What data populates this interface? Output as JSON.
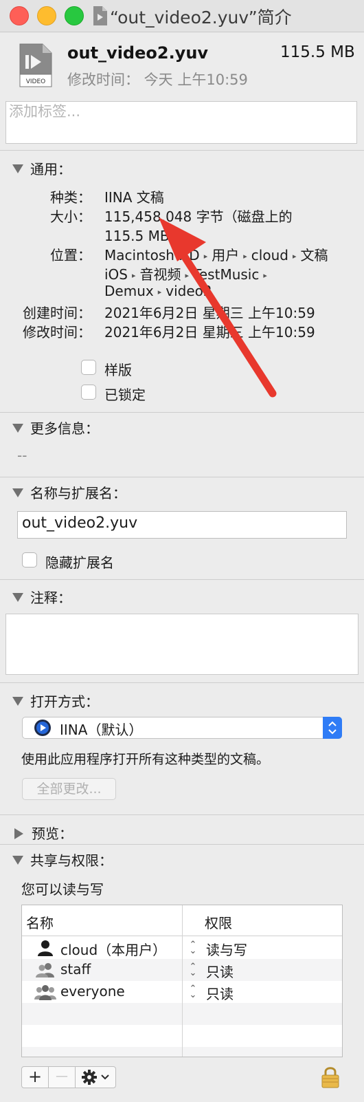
{
  "window": {
    "title": "“out_video2.yuv”简介",
    "colors": {
      "close": "#fe5f57",
      "minimize": "#febc2e",
      "zoom": "#28c840",
      "accent": "#2f7cf6",
      "annotation_arrow": "#e8382d"
    }
  },
  "header": {
    "filename": "out_video2.yuv",
    "size": "115.5 MB",
    "modified": "修改时间： 今天 上午10:59",
    "icon_label": "VIDEO"
  },
  "tags": {
    "placeholder": "添加标签..."
  },
  "general": {
    "heading": "通用：",
    "kind_label": "种类：",
    "kind_value": "IINA 文稿",
    "size_label": "大小：",
    "size_line1": "115,458,048 字节（磁盘上的",
    "size_line2": "115.5 MB）",
    "where_label": "位置：",
    "path": [
      "Macintosh HD",
      "用户",
      "cloud",
      "文稿",
      "iOS",
      "音视频",
      "TestMusic",
      "Demux",
      "video2"
    ],
    "created_label": "创建时间：",
    "created_value": "2021年6月2日 星期三 上午10:59",
    "modified_label": "修改时间：",
    "modified_value": "2021年6月2日 星期三 上午10:59",
    "stationery_label": "样版",
    "locked_label": "已锁定"
  },
  "more_info": {
    "heading": "更多信息：",
    "value": "--"
  },
  "name_ext": {
    "heading": "名称与扩展名：",
    "value": "out_video2.yuv",
    "hide_ext_label": "隐藏扩展名"
  },
  "comments": {
    "heading": "注释："
  },
  "open_with": {
    "heading": "打开方式：",
    "app": "IINA（默认）",
    "description": "使用此应用程序打开所有这种类型的文稿。",
    "change_all": "全部更改..."
  },
  "preview": {
    "heading": "预览："
  },
  "sharing": {
    "heading": "共享与权限：",
    "summary": "您可以读与写",
    "col_name": "名称",
    "col_privilege": "权限",
    "rows": [
      {
        "name": "cloud（本用户）",
        "privilege": "读与写",
        "icon": "user-icon"
      },
      {
        "name": "staff",
        "privilege": "只读",
        "icon": "group-icon"
      },
      {
        "name": "everyone",
        "privilege": "只读",
        "icon": "everyone-icon"
      }
    ]
  },
  "toolbar": {
    "add": "+",
    "remove": "—"
  }
}
